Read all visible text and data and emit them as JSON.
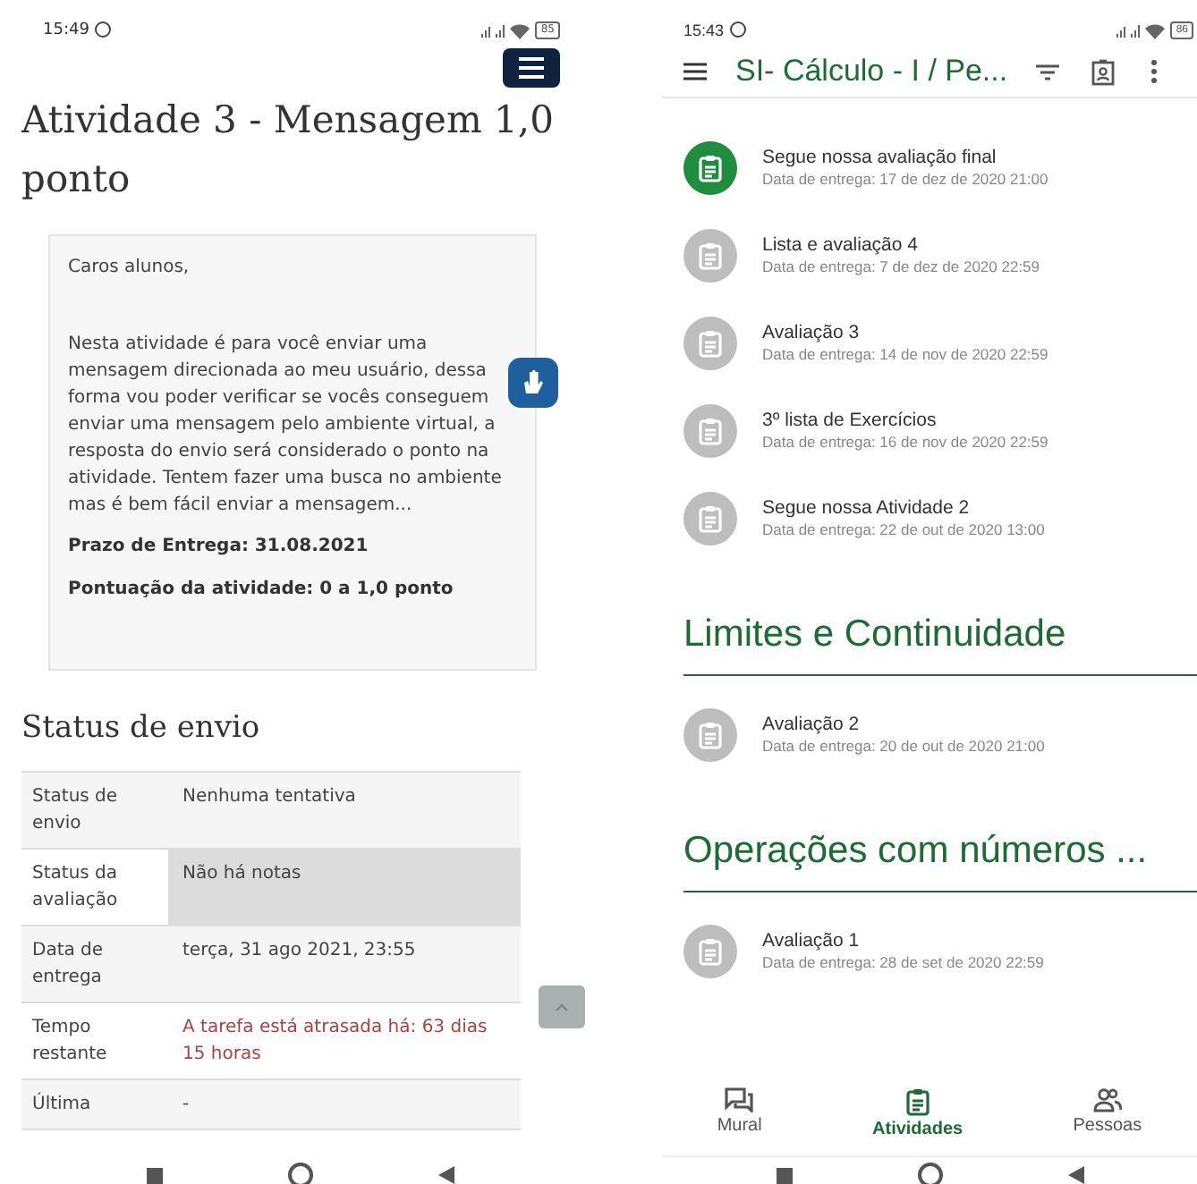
{
  "left_phone": {
    "status_bar": {
      "time": "15:49",
      "battery": "85"
    },
    "title": "Atividade 3 - Mensagem 1,0 ponto",
    "description": {
      "greeting": "Caros alunos,",
      "body": "Nesta atividade é para você enviar uma mensagem direcionada ao meu usuário, dessa forma vou poder verificar se vocês conseguem enviar uma mensagem pelo ambiente virtual, a resposta do envio será considerado o ponto na atividade.  Tentem fazer uma busca no ambiente mas é bem fácil enviar a mensagem...",
      "deadline": "Prazo de Entrega: 31.08.2021",
      "score": "Pontuação da atividade: 0 a 1,0 ponto"
    },
    "section_title": "Status de envio",
    "table": {
      "rows": [
        {
          "label": "Status de envio",
          "value": "Nenhuma tentativa",
          "highlighted": false,
          "overdue": false
        },
        {
          "label": "Status da avaliação",
          "value": "Não há notas",
          "highlighted": true,
          "overdue": false
        },
        {
          "label": "Data de entrega",
          "value": "terça, 31 ago 2021, 23:55",
          "highlighted": false,
          "overdue": false
        },
        {
          "label": "Tempo restante",
          "value": "A tarefa está atrasada há: 63 dias 15 horas",
          "highlighted": false,
          "overdue": true
        },
        {
          "label": "Última",
          "value": "-",
          "highlighted": false,
          "overdue": false
        }
      ]
    }
  },
  "right_phone": {
    "status_bar": {
      "time": "15:43",
      "battery": "86"
    },
    "app_bar": {
      "title": "SI- Cálculo - I / Pe..."
    },
    "sections": [
      {
        "items": [
          {
            "title": "Segue nossa avaliação final",
            "due": "Data de entrega: 17 de dez de 2020 21:00",
            "color": "#1e8e3e"
          },
          {
            "title": "Lista e avaliação 4",
            "due": "Data de entrega: 7 de dez de 2020 22:59",
            "color": "#bdbdbd"
          },
          {
            "title": "Avaliação 3",
            "due": "Data de entrega: 14 de nov de 2020 22:59",
            "color": "#bdbdbd"
          },
          {
            "title": "3º lista de Exercícios",
            "due": "Data de entrega: 16 de nov de 2020 22:59",
            "color": "#bdbdbd"
          },
          {
            "title": "Segue nossa Atividade 2",
            "due": "Data de entrega: 22 de out de 2020 13:00",
            "color": "#bdbdbd"
          }
        ]
      },
      {
        "heading": "Limites e Continuidade",
        "items": [
          {
            "title": "Avaliação 2",
            "due": "Data de entrega: 20 de out de 2020 21:00",
            "color": "#bdbdbd"
          }
        ]
      },
      {
        "heading": "Operações com números ...",
        "items": [
          {
            "title": "Avaliação 1",
            "due": "Data de entrega: 28 de set de 2020 22:59",
            "color": "#bdbdbd"
          }
        ]
      }
    ],
    "bottom_nav": [
      {
        "label": "Mural",
        "kind": "stream",
        "selected": false
      },
      {
        "label": "Atividades",
        "kind": "classwork",
        "selected": true
      },
      {
        "label": "Pessoas",
        "kind": "people",
        "selected": false
      }
    ]
  }
}
